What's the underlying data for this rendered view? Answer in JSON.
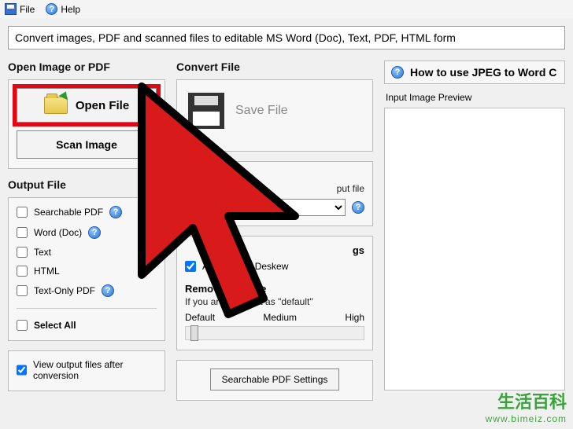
{
  "menu": {
    "file": "File",
    "help": "Help"
  },
  "banner": "Convert images, PDF and scanned files to editable MS Word (Doc), Text, PDF, HTML form",
  "left": {
    "open_title": "Open Image or PDF",
    "open_file_btn": "Open File",
    "scan_btn": "Scan Image",
    "output_title": "Output File",
    "formats": {
      "searchable_pdf": "Searchable PDF",
      "word_doc": "Word (Doc)",
      "text": "Text",
      "html": "HTML",
      "text_only_pdf": "Text-Only PDF"
    },
    "select_all": "Select All",
    "view_output": "View output files after conversion"
  },
  "mid": {
    "convert_title": "Convert File",
    "save_file": "Save File",
    "lang_partial": "put file",
    "settings_partial": "gs",
    "auto_partial": "Au",
    "deskew": "Deskew",
    "remove_title": "Remove          n Image",
    "remove_note": "If you are n       keep it as \"default\"",
    "slider": {
      "low": "Default",
      "mid": "Medium",
      "high": "High"
    },
    "searchable_btn": "Searchable PDF Settings"
  },
  "right": {
    "howto": "How to use JPEG to Word C",
    "preview_label": "Input Image Preview"
  },
  "watermark": {
    "brand": "生活百科",
    "url": "www.bimeiz.com"
  },
  "help_glyph": "?"
}
